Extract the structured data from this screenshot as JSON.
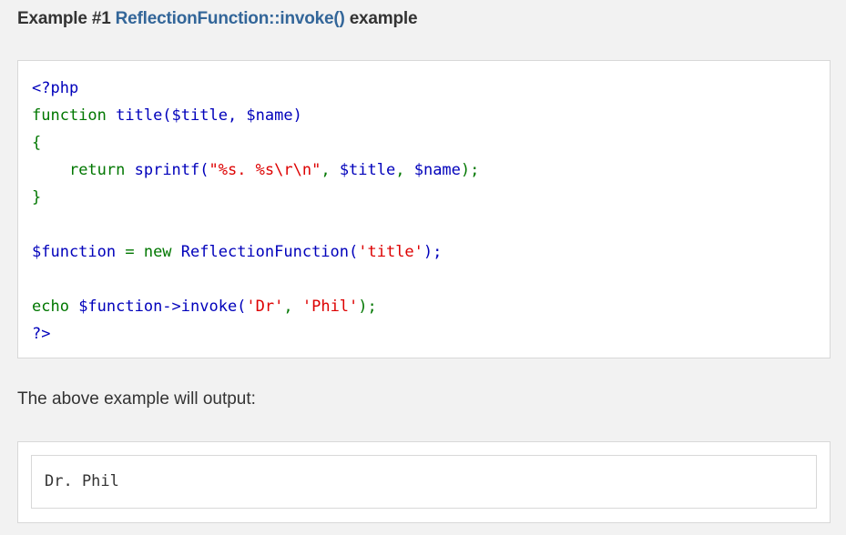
{
  "example": {
    "prefix": "Example #1 ",
    "function_link": "ReflectionFunction::invoke()",
    "suffix": " example"
  },
  "code": {
    "line1": {
      "open_tag": "<?php"
    },
    "line2": {
      "kw_function": "function ",
      "name_params": "title($title, $name)"
    },
    "line3": {
      "brace_open": "{"
    },
    "line4": {
      "indent": "    ",
      "kw_return": "return ",
      "call": "sprintf(",
      "fmt": "\"%s. %s\\r\\n\"",
      "comma1": ", ",
      "arg1": "$title",
      "comma2": ", ",
      "arg2": "$name",
      "close": ");"
    },
    "line5": {
      "brace_close": "}"
    },
    "line7": {
      "var": "$function ",
      "assign": "= new ",
      "cls": "ReflectionFunction(",
      "arg": "'title'",
      "close": ");"
    },
    "line9": {
      "kw_echo": "echo ",
      "call": "$function->invoke(",
      "arg1": "'Dr'",
      "comma": ", ",
      "arg2": "'Phil'",
      "close": ");"
    },
    "line10": {
      "close_tag": "?>"
    }
  },
  "output_label": "The above example will output:",
  "output_text": "Dr. Phil",
  "colors": {
    "default": "#0000bb",
    "keyword": "#007700",
    "string": "#dd0000",
    "link": "#336699"
  }
}
